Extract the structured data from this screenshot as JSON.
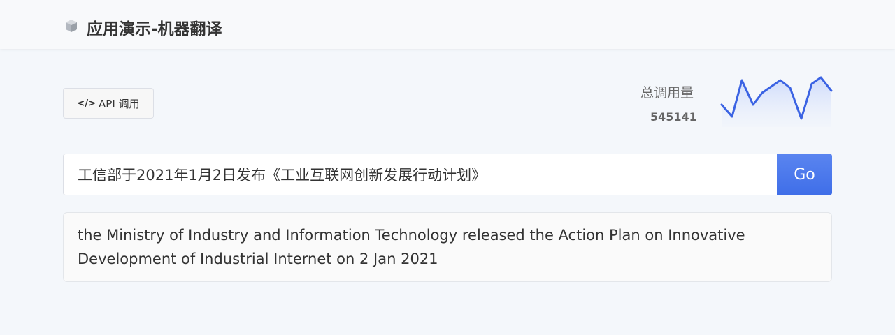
{
  "header": {
    "logo_icon": "cube-icon",
    "title": "应用演示-机器翻译"
  },
  "toolbar": {
    "api_icon_text": "</>",
    "api_label": "API 调用"
  },
  "usage": {
    "label": "总调用量",
    "value": "545141",
    "sparkline_color": "#3b63e3"
  },
  "translate": {
    "source_text": "工信部于2021年1月2日发布《工业互联网创新发展行动计划》",
    "go_label": "Go",
    "result_text": "the Ministry of Industry and Information Technology released the Action Plan on Innovative Development of Industrial Internet on 2 Jan 2021"
  },
  "colors": {
    "accent": "#4a78ec",
    "background": "#f4f7fb"
  }
}
